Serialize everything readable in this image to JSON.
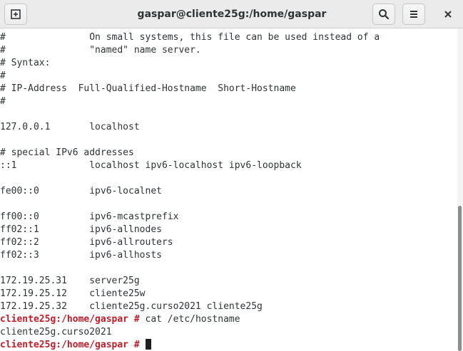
{
  "window": {
    "title": "gaspar@cliente25g:/home/gaspar"
  },
  "icons": {
    "new_tab": "new-tab-icon",
    "search": "search-icon",
    "menu": "hamburger-menu-icon",
    "close": "close-icon"
  },
  "terminal": {
    "lines": [
      "#               On small systems, this file can be used instead of a",
      "#               \"named\" name server.",
      "# Syntax:",
      "#",
      "# IP-Address  Full-Qualified-Hostname  Short-Hostname",
      "#",
      "",
      "127.0.0.1       localhost",
      "",
      "# special IPv6 addresses",
      "::1             localhost ipv6-localhost ipv6-loopback",
      "",
      "fe00::0         ipv6-localnet",
      "",
      "ff00::0         ipv6-mcastprefix",
      "ff02::1         ipv6-allnodes",
      "ff02::2         ipv6-allrouters",
      "ff02::3         ipv6-allhosts",
      "",
      "172.19.25.31    server25g",
      "172.19.25.12    cliente25w",
      "172.19.25.32    cliente25g.curso2021 cliente25g"
    ],
    "prompt": "cliente25g:/home/gaspar",
    "prompt_symbol": " # ",
    "command": "cat /etc/hostname",
    "output": "cliente25g.curso2021"
  },
  "colors": {
    "prompt": "#c01c28",
    "text": "#2e3436",
    "background": "#ffffff",
    "titlebar": "#ebebeb"
  }
}
